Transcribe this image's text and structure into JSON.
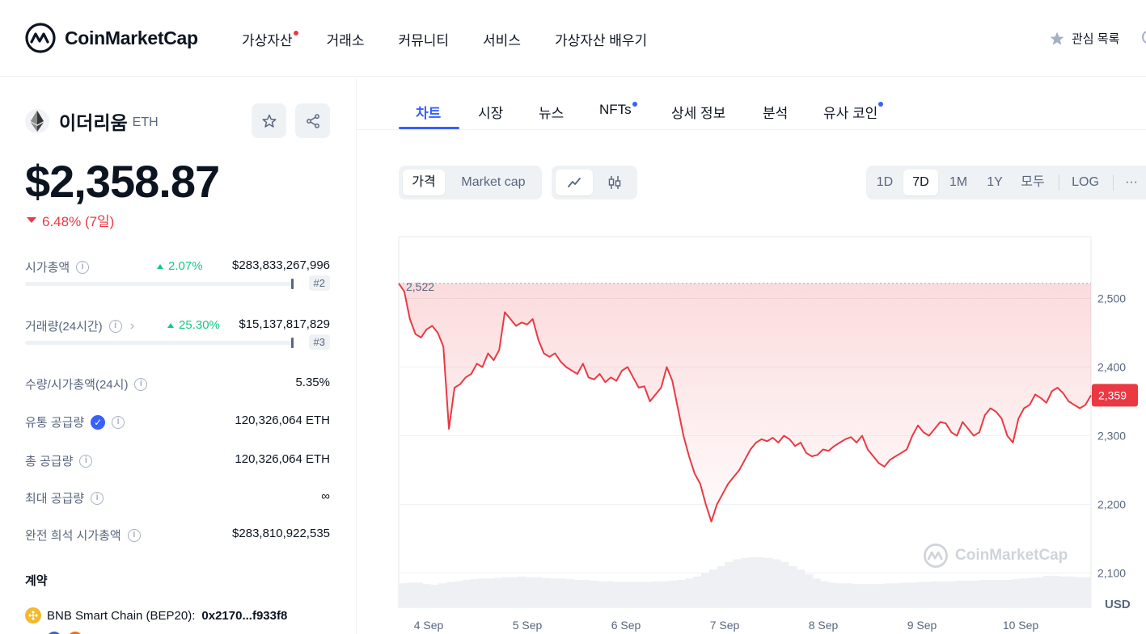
{
  "header": {
    "brand": "CoinMarketCap",
    "nav": [
      {
        "label": "가상자산",
        "dot": true
      },
      {
        "label": "거래소",
        "dot": false
      },
      {
        "label": "커뮤니티",
        "dot": false
      },
      {
        "label": "서비스",
        "dot": false
      },
      {
        "label": "가상자산 배우기",
        "dot": false
      }
    ],
    "watchlist": "관심 목록"
  },
  "coin": {
    "name": "이더리움",
    "symbol": "ETH",
    "price": "$2,358.87",
    "change": "6.48% (7일)",
    "stats": {
      "market_cap": {
        "label": "시가총액",
        "pct": "2.07%",
        "value": "$283,833,267,996",
        "rank": "#2"
      },
      "volume": {
        "label": "거래량(24시간)",
        "pct": "25.30%",
        "value": "$15,137,817,829",
        "rank": "#3"
      },
      "vol_mcap": {
        "label": "수량/시가총액(24시)",
        "value": "5.35%"
      },
      "circulating": {
        "label": "유통 공급량",
        "value": "120,326,064 ETH"
      },
      "total": {
        "label": "총 공급량",
        "value": "120,326,064 ETH"
      },
      "max": {
        "label": "최대 공급량",
        "value": "∞"
      },
      "fdv": {
        "label": "완전 희석 시가총액",
        "value": "$283,810,922,535"
      }
    },
    "contracts_title": "계약",
    "contract": {
      "chain": "BNB Smart Chain (BEP20):",
      "address": "0x2170...f933f8"
    }
  },
  "tabs": [
    {
      "label": "차트",
      "active": true,
      "dot": false
    },
    {
      "label": "시장",
      "active": false,
      "dot": false
    },
    {
      "label": "뉴스",
      "active": false,
      "dot": false
    },
    {
      "label": "NFTs",
      "active": false,
      "dot": true
    },
    {
      "label": "상세 정보",
      "active": false,
      "dot": false
    },
    {
      "label": "분석",
      "active": false,
      "dot": false
    },
    {
      "label": "유사 코인",
      "active": false,
      "dot": true
    }
  ],
  "controls": {
    "mode": [
      "가격",
      "Market cap"
    ],
    "ranges": [
      "1D",
      "7D",
      "1M",
      "1Y",
      "모두"
    ],
    "active_range": "7D",
    "log": "LOG",
    "more": "···"
  },
  "colors": {
    "accent": "#3861fb",
    "down": "#ea3943",
    "up": "#16c784"
  },
  "chart_data": {
    "type": "line",
    "x": [
      "2024-09-04",
      "2024-09-05",
      "2024-09-06",
      "2024-09-07",
      "2024-09-08",
      "2024-09-09",
      "2024-09-10"
    ],
    "x_tick_labels": [
      "4 Sep",
      "5 Sep",
      "6 Sep",
      "7 Sep",
      "8 Sep",
      "9 Sep",
      "10 Sep"
    ],
    "y_ticks": [
      2500,
      2400,
      2300,
      2200,
      2100
    ],
    "y_tick_labels": [
      "2,500",
      "2,400",
      "2,300",
      "2,200",
      "2,100"
    ],
    "ylim": [
      2050,
      2590
    ],
    "unit": "USD",
    "start_label": "2,522",
    "current_label": "2,359",
    "series": [
      {
        "values": [
          2522,
          2510,
          2470,
          2448,
          2443,
          2455,
          2460,
          2450,
          2430,
          2310,
          2370,
          2375,
          2385,
          2390,
          2405,
          2400,
          2420,
          2410,
          2425,
          2480,
          2470,
          2460,
          2465,
          2462,
          2470,
          2440,
          2420,
          2415,
          2420,
          2408,
          2400,
          2395,
          2390,
          2405,
          2385,
          2382,
          2390,
          2378,
          2385,
          2380,
          2395,
          2400,
          2385,
          2370,
          2372,
          2350,
          2360,
          2370,
          2400,
          2380,
          2340,
          2300,
          2270,
          2245,
          2230,
          2200,
          2175,
          2200,
          2215,
          2230,
          2240,
          2250,
          2265,
          2280,
          2290,
          2295,
          2292,
          2297,
          2290,
          2300,
          2295,
          2285,
          2290,
          2275,
          2270,
          2272,
          2280,
          2278,
          2285,
          2290,
          2295,
          2298,
          2290,
          2300,
          2280,
          2270,
          2260,
          2255,
          2265,
          2270,
          2275,
          2280,
          2300,
          2315,
          2305,
          2300,
          2310,
          2320,
          2318,
          2305,
          2300,
          2320,
          2310,
          2300,
          2305,
          2330,
          2340,
          2335,
          2325,
          2300,
          2290,
          2325,
          2340,
          2345,
          2360,
          2355,
          2348,
          2365,
          2370,
          2362,
          2350,
          2345,
          2340,
          2345,
          2359
        ],
        "color": "#ea3943"
      }
    ],
    "volume": [
      35,
      36,
      36,
      34,
      33,
      35,
      37,
      38,
      40,
      41,
      42,
      42,
      43,
      44,
      44,
      45,
      44,
      44,
      43,
      42,
      42,
      41,
      40,
      40,
      39,
      38,
      38,
      37,
      37,
      37,
      37,
      37,
      38,
      38,
      39,
      40,
      42,
      45,
      50,
      55,
      60,
      66,
      70,
      72,
      73,
      73,
      72,
      70,
      66,
      60,
      55,
      48,
      42,
      38,
      36,
      35,
      35,
      34,
      34,
      34,
      34,
      35,
      35,
      36,
      36,
      37,
      37,
      38,
      38,
      38,
      39,
      39,
      39,
      40,
      40,
      40,
      40,
      41,
      42,
      43,
      44,
      46,
      46,
      45,
      45,
      44,
      44
    ]
  }
}
